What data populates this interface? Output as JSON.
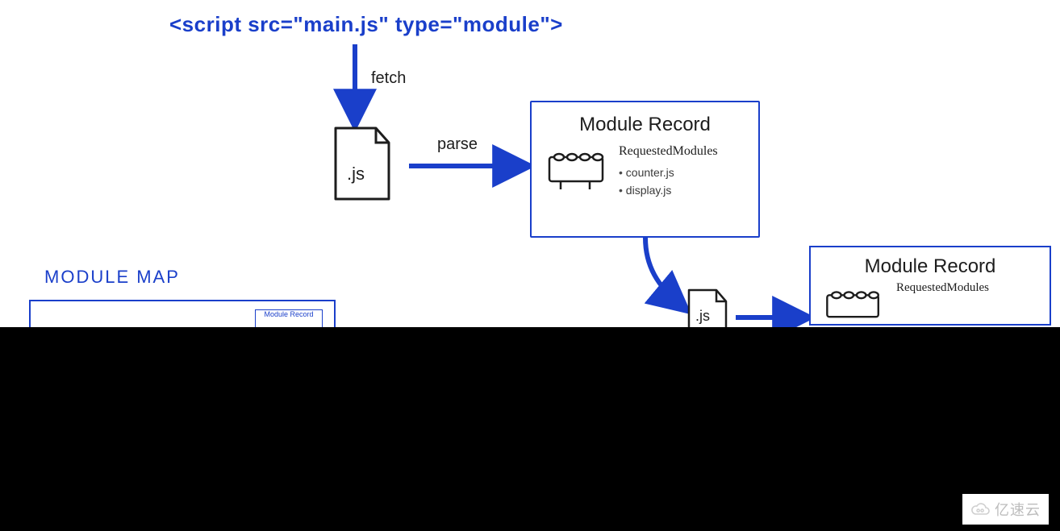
{
  "title_code": "<script src=\"main.js\" type=\"module\">",
  "labels": {
    "fetch": "fetch",
    "parse": "parse",
    "js_ext": ".js",
    "js_ext_small": ".js"
  },
  "module_record_main": {
    "title": "Module Record",
    "requested_header": "RequestedModules",
    "requested": [
      "counter.js",
      "display.js"
    ]
  },
  "module_record_secondary": {
    "title": "Module Record",
    "requested_header": "RequestedModules"
  },
  "module_map": {
    "heading": "MODULE MAP",
    "mini_label": "Module Record"
  },
  "watermark": "亿速云"
}
